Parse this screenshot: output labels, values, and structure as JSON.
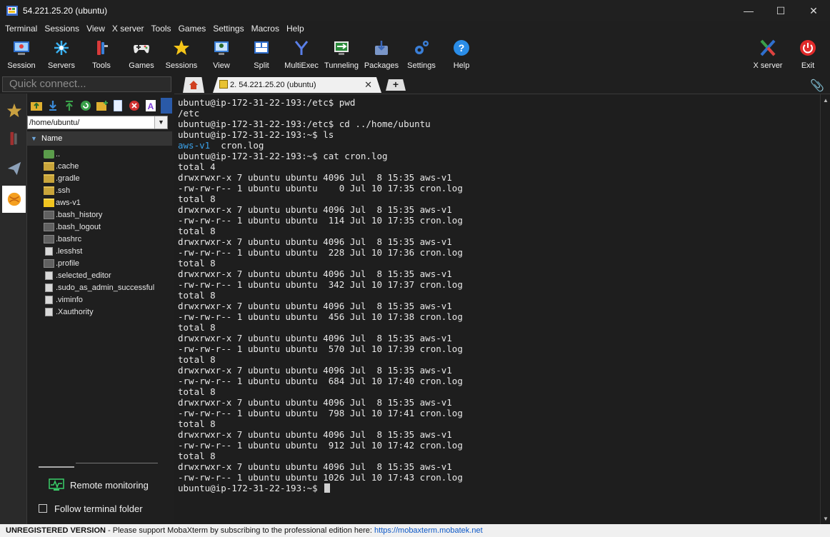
{
  "window": {
    "title": "54.221.25.20 (ubuntu)",
    "min": "—",
    "max": "☐",
    "close": "✕"
  },
  "menu": [
    "Terminal",
    "Sessions",
    "View",
    "X server",
    "Tools",
    "Games",
    "Settings",
    "Macros",
    "Help"
  ],
  "toolbar": {
    "items": [
      "Session",
      "Servers",
      "Tools",
      "Games",
      "Sessions",
      "View",
      "Split",
      "MultiExec",
      "Tunneling",
      "Packages",
      "Settings",
      "Help"
    ],
    "xserver": "X server",
    "exit": "Exit"
  },
  "quick_connect": {
    "placeholder": "Quick connect..."
  },
  "tabs": {
    "session_label": "2. 54.221.25.20 (ubuntu)",
    "close": "✕",
    "add": "+"
  },
  "browser": {
    "path": "/home/ubuntu/",
    "column": "Name",
    "files": [
      {
        "name": "..",
        "kind": "up"
      },
      {
        "name": ".cache",
        "kind": "folder"
      },
      {
        "name": ".gradle",
        "kind": "folder"
      },
      {
        "name": ".ssh",
        "kind": "folder"
      },
      {
        "name": "aws-v1",
        "kind": "folder-open"
      },
      {
        "name": ".bash_history",
        "kind": "doc"
      },
      {
        "name": ".bash_logout",
        "kind": "doc"
      },
      {
        "name": ".bashrc",
        "kind": "doc"
      },
      {
        "name": ".lesshst",
        "kind": "page"
      },
      {
        "name": ".profile",
        "kind": "doc"
      },
      {
        "name": ".selected_editor",
        "kind": "page"
      },
      {
        "name": ".sudo_as_admin_successful",
        "kind": "page"
      },
      {
        "name": ".viminfo",
        "kind": "page"
      },
      {
        "name": ".Xauthority",
        "kind": "page"
      }
    ],
    "remote_monitoring": "Remote monitoring",
    "follow_folder": "Follow terminal folder"
  },
  "terminal": {
    "lines": [
      "ubuntu@ip-172-31-22-193:/etc$ pwd",
      "/etc",
      "ubuntu@ip-172-31-22-193:/etc$ cd ../home/ubuntu",
      "ubuntu@ip-172-31-22-193:~$ ls",
      "__LS__",
      "ubuntu@ip-172-31-22-193:~$ cat cron.log",
      "total 4",
      "drwxrwxr-x 7 ubuntu ubuntu 4096 Jul  8 15:35 aws-v1",
      "-rw-rw-r-- 1 ubuntu ubuntu    0 Jul 10 17:35 cron.log",
      "total 8",
      "drwxrwxr-x 7 ubuntu ubuntu 4096 Jul  8 15:35 aws-v1",
      "-rw-rw-r-- 1 ubuntu ubuntu  114 Jul 10 17:35 cron.log",
      "total 8",
      "drwxrwxr-x 7 ubuntu ubuntu 4096 Jul  8 15:35 aws-v1",
      "-rw-rw-r-- 1 ubuntu ubuntu  228 Jul 10 17:36 cron.log",
      "total 8",
      "drwxrwxr-x 7 ubuntu ubuntu 4096 Jul  8 15:35 aws-v1",
      "-rw-rw-r-- 1 ubuntu ubuntu  342 Jul 10 17:37 cron.log",
      "total 8",
      "drwxrwxr-x 7 ubuntu ubuntu 4096 Jul  8 15:35 aws-v1",
      "-rw-rw-r-- 1 ubuntu ubuntu  456 Jul 10 17:38 cron.log",
      "total 8",
      "drwxrwxr-x 7 ubuntu ubuntu 4096 Jul  8 15:35 aws-v1",
      "-rw-rw-r-- 1 ubuntu ubuntu  570 Jul 10 17:39 cron.log",
      "total 8",
      "drwxrwxr-x 7 ubuntu ubuntu 4096 Jul  8 15:35 aws-v1",
      "-rw-rw-r-- 1 ubuntu ubuntu  684 Jul 10 17:40 cron.log",
      "total 8",
      "drwxrwxr-x 7 ubuntu ubuntu 4096 Jul  8 15:35 aws-v1",
      "-rw-rw-r-- 1 ubuntu ubuntu  798 Jul 10 17:41 cron.log",
      "total 8",
      "drwxrwxr-x 7 ubuntu ubuntu 4096 Jul  8 15:35 aws-v1",
      "-rw-rw-r-- 1 ubuntu ubuntu  912 Jul 10 17:42 cron.log",
      "total 8",
      "drwxrwxr-x 7 ubuntu ubuntu 4096 Jul  8 15:35 aws-v1",
      "-rw-rw-r-- 1 ubuntu ubuntu 1026 Jul 10 17:43 cron.log",
      "ubuntu@ip-172-31-22-193:~$ "
    ],
    "ls_dir": "aws-v1",
    "ls_file": "  cron.log",
    "dir_color": "#3aa0e8"
  },
  "status": {
    "unregistered": "UNREGISTERED VERSION",
    "message": " -  Please support MobaXterm by subscribing to the professional edition here: ",
    "link": "https://mobaxterm.mobatek.net"
  }
}
